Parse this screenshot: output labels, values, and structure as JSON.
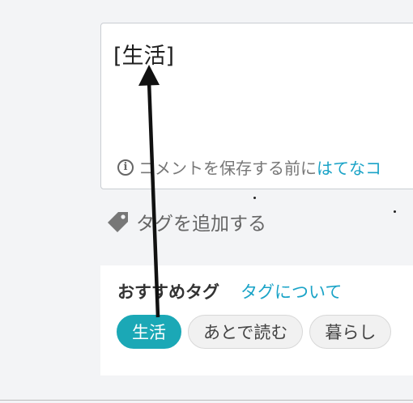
{
  "comment": {
    "text": "[生活]",
    "note_prefix": "コメントを保存する前に",
    "note_link": "はてなコ"
  },
  "add_tag": {
    "label": "タグを追加する"
  },
  "recommend": {
    "title": "おすすめタグ",
    "link": "タグについて",
    "tags": [
      {
        "label": "生活",
        "selected": true
      },
      {
        "label": "あとで読む",
        "selected": false
      },
      {
        "label": "暮らし",
        "selected": false
      }
    ]
  },
  "colors": {
    "accent": "#1aa3c7",
    "tag_selected": "#1ba8b6",
    "annotation_arrow": "#111111"
  },
  "icons": {
    "info": "info-icon",
    "tag": "tag-icon"
  }
}
